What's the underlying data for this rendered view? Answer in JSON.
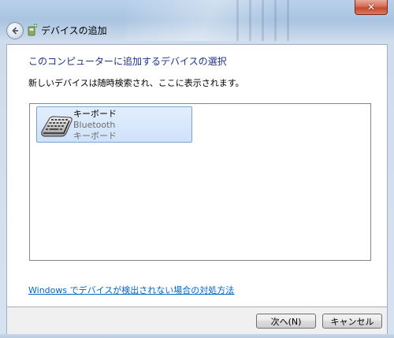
{
  "window": {
    "title": "デバイスの追加",
    "close_label": "✕"
  },
  "icons": {
    "back": "back-arrow-icon",
    "title": "add-device-icon",
    "keyboard": "keyboard-icon"
  },
  "content": {
    "heading": "このコンピューターに追加するデバイスの選択",
    "subtext": "新しいデバイスは随時検索され、ここに表示されます。",
    "devices": [
      {
        "name": "キーボード",
        "connection": "Bluetooth",
        "category": "キーボード"
      }
    ],
    "help_link": "Windows でデバイスが検出されない場合の対処方法"
  },
  "footer": {
    "next_label": "次へ(N)",
    "cancel_label": "キャンセル"
  },
  "colors": {
    "heading": "#1e3287",
    "link": "#0066cc",
    "selection_fill": "#d5e6fb",
    "selection_border": "#7da2ce"
  }
}
